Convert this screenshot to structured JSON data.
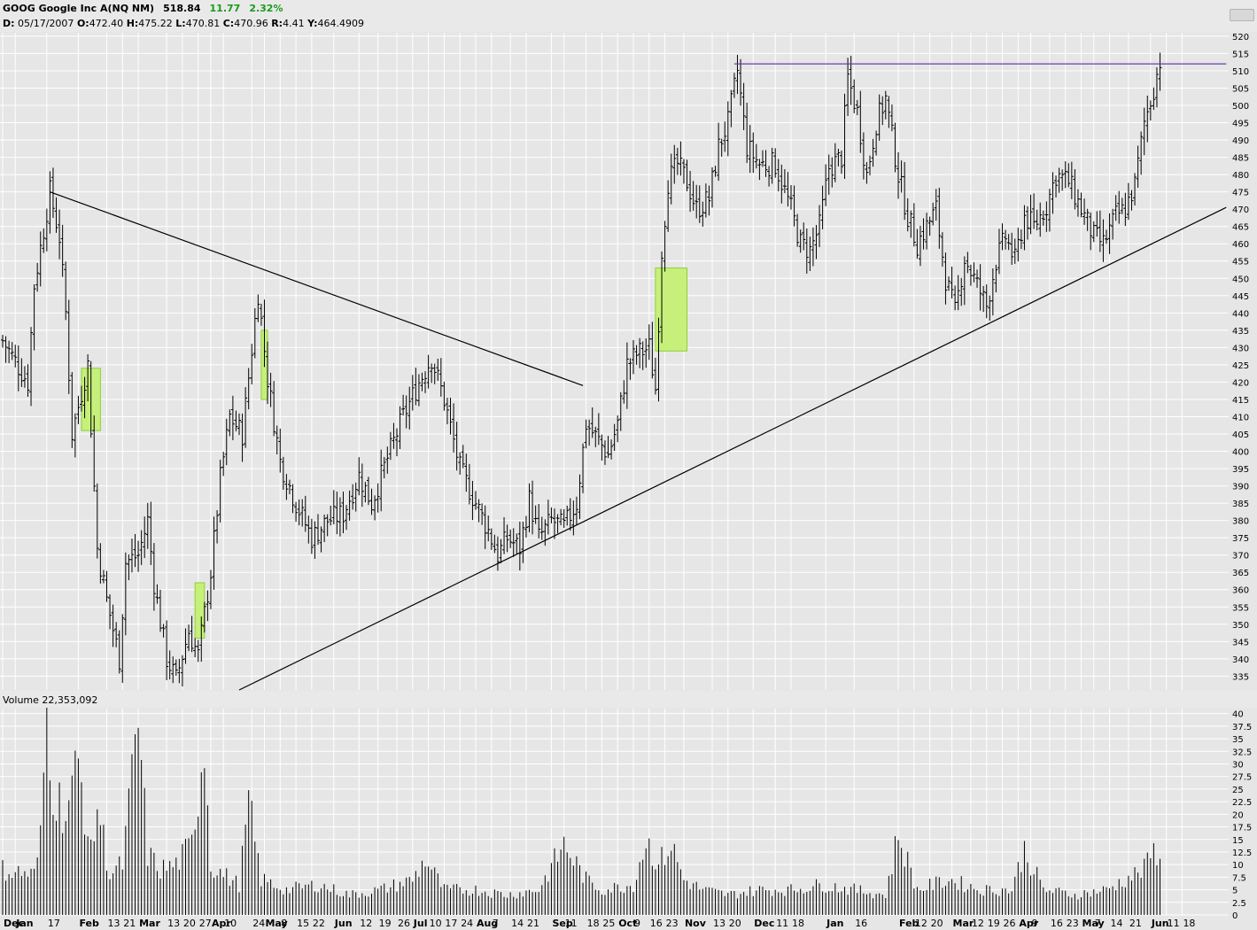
{
  "header": {
    "symbol_name": "GOOG Google Inc A(NQ NM)",
    "last_price": "518.84",
    "change": "11.77",
    "change_pct": "2.32%",
    "change_color": "#1a9a1a"
  },
  "ohlc": {
    "d_label": "D:",
    "date": "05/17/2007",
    "o_label": "O:",
    "open": "472.40",
    "h_label": "H:",
    "high": "475.22",
    "l_label": "L:",
    "low": "470.81",
    "c_label": "C:",
    "close": "470.96",
    "r_label": "R:",
    "range": "4.41",
    "y_label": "Y:",
    "y_value": "464.4909"
  },
  "volume_panel": {
    "label": "Volume 22,353,092"
  },
  "colors": {
    "background": "#e6e6e6",
    "grid": "#ffffff",
    "bars": "#000000",
    "trendlines": "#000000",
    "resistance_line": "#6a3cb4",
    "gap_box_fill": "#c6f07a",
    "gap_box_stroke": "#8ed03a"
  },
  "chart_data": {
    "type": "ohlc",
    "price_axis": {
      "ylim": [
        331,
        521
      ],
      "ticks": [
        335,
        340,
        345,
        350,
        355,
        360,
        365,
        370,
        375,
        380,
        385,
        390,
        395,
        400,
        405,
        410,
        415,
        420,
        425,
        430,
        435,
        440,
        445,
        450,
        455,
        460,
        465,
        470,
        475,
        480,
        485,
        490,
        495,
        500,
        505,
        510,
        515,
        520
      ],
      "position": "right",
      "grid": true
    },
    "volume_axis": {
      "ylim": [
        0,
        41
      ],
      "ticks": [
        "0",
        "2.5",
        "5",
        "7.5",
        "10",
        "12.5",
        "15",
        "17.5",
        "20",
        "22.5",
        "25",
        "27.5",
        "30",
        "32.5",
        "35",
        "37.5",
        "40"
      ],
      "unit": "millions",
      "position": "right",
      "grid": true
    },
    "x_axis": {
      "tick_labels": [
        {
          "i": 0,
          "label": "Dec",
          "bold": true
        },
        {
          "i": 4,
          "label": "Jan",
          "bold": true
        },
        {
          "i": 14,
          "label": "17",
          "bold": false
        },
        {
          "i": 24,
          "label": "Feb",
          "bold": true
        },
        {
          "i": 33,
          "label": "13",
          "bold": false
        },
        {
          "i": 38,
          "label": "21",
          "bold": false
        },
        {
          "i": 43,
          "label": "Mar",
          "bold": true
        },
        {
          "i": 52,
          "label": "13",
          "bold": false
        },
        {
          "i": 57,
          "label": "20",
          "bold": false
        },
        {
          "i": 62,
          "label": "27",
          "bold": false
        },
        {
          "i": 66,
          "label": "Apr",
          "bold": true
        },
        {
          "i": 70,
          "label": "10",
          "bold": false
        },
        {
          "i": 79,
          "label": "24",
          "bold": false
        },
        {
          "i": 83,
          "label": "May",
          "bold": true
        },
        {
          "i": 88,
          "label": "8",
          "bold": false
        },
        {
          "i": 93,
          "label": "15",
          "bold": false
        },
        {
          "i": 98,
          "label": "22",
          "bold": false
        },
        {
          "i": 105,
          "label": "Jun",
          "bold": true
        },
        {
          "i": 113,
          "label": "12",
          "bold": false
        },
        {
          "i": 119,
          "label": "19",
          "bold": false
        },
        {
          "i": 125,
          "label": "26",
          "bold": false
        },
        {
          "i": 130,
          "label": "Jul",
          "bold": true
        },
        {
          "i": 135,
          "label": "10",
          "bold": false
        },
        {
          "i": 140,
          "label": "17",
          "bold": false
        },
        {
          "i": 145,
          "label": "24",
          "bold": false
        },
        {
          "i": 150,
          "label": "Aug",
          "bold": true
        },
        {
          "i": 155,
          "label": "7",
          "bold": false
        },
        {
          "i": 161,
          "label": "14",
          "bold": false
        },
        {
          "i": 166,
          "label": "21",
          "bold": false
        },
        {
          "i": 174,
          "label": "Sep",
          "bold": true
        },
        {
          "i": 178,
          "label": "11",
          "bold": false
        },
        {
          "i": 185,
          "label": "18",
          "bold": false
        },
        {
          "i": 190,
          "label": "25",
          "bold": false
        },
        {
          "i": 195,
          "label": "Oct",
          "bold": true
        },
        {
          "i": 200,
          "label": "9",
          "bold": false
        },
        {
          "i": 205,
          "label": "16",
          "bold": false
        },
        {
          "i": 210,
          "label": "23",
          "bold": false
        },
        {
          "i": 216,
          "label": "Nov",
          "bold": true
        },
        {
          "i": 225,
          "label": "13",
          "bold": false
        },
        {
          "i": 230,
          "label": "20",
          "bold": false
        },
        {
          "i": 238,
          "label": "Dec",
          "bold": true
        },
        {
          "i": 245,
          "label": "11",
          "bold": false
        },
        {
          "i": 250,
          "label": "18",
          "bold": false
        },
        {
          "i": 261,
          "label": "Jan",
          "bold": true
        },
        {
          "i": 270,
          "label": "16",
          "bold": false
        },
        {
          "i": 284,
          "label": "Feb",
          "bold": true
        },
        {
          "i": 289,
          "label": "12",
          "bold": false
        },
        {
          "i": 294,
          "label": "20",
          "bold": false
        },
        {
          "i": 301,
          "label": "Mar",
          "bold": true
        },
        {
          "i": 307,
          "label": "12",
          "bold": false
        },
        {
          "i": 312,
          "label": "19",
          "bold": false
        },
        {
          "i": 317,
          "label": "26",
          "bold": false
        },
        {
          "i": 322,
          "label": "Apr",
          "bold": true
        },
        {
          "i": 326,
          "label": "9",
          "bold": false
        },
        {
          "i": 332,
          "label": "16",
          "bold": false
        },
        {
          "i": 337,
          "label": "23",
          "bold": false
        },
        {
          "i": 342,
          "label": "May",
          "bold": true
        },
        {
          "i": 346,
          "label": "7",
          "bold": false
        },
        {
          "i": 351,
          "label": "14",
          "bold": false
        },
        {
          "i": 357,
          "label": "21",
          "bold": false
        },
        {
          "i": 364,
          "label": "Jun",
          "bold": true
        },
        {
          "i": 369,
          "label": "11",
          "bold": false
        },
        {
          "i": 374,
          "label": "18",
          "bold": false
        }
      ]
    },
    "price_keypoints": [
      [
        0,
        432
      ],
      [
        8,
        420
      ],
      [
        10,
        448
      ],
      [
        15,
        475
      ],
      [
        18,
        462
      ],
      [
        20,
        440
      ],
      [
        22,
        405
      ],
      [
        27,
        425
      ],
      [
        30,
        372
      ],
      [
        33,
        357
      ],
      [
        37,
        340
      ],
      [
        39,
        368
      ],
      [
        43,
        370
      ],
      [
        46,
        380
      ],
      [
        48,
        362
      ],
      [
        52,
        340
      ],
      [
        55,
        334
      ],
      [
        59,
        348
      ],
      [
        62,
        341
      ],
      [
        66,
        365
      ],
      [
        69,
        392
      ],
      [
        72,
        410
      ],
      [
        76,
        405
      ],
      [
        81,
        446
      ],
      [
        84,
        421
      ],
      [
        88,
        397
      ],
      [
        93,
        385
      ],
      [
        98,
        375
      ],
      [
        103,
        380
      ],
      [
        108,
        382
      ],
      [
        113,
        393
      ],
      [
        117,
        385
      ],
      [
        122,
        398
      ],
      [
        127,
        410
      ],
      [
        132,
        420
      ],
      [
        136,
        427
      ],
      [
        140,
        415
      ],
      [
        145,
        395
      ],
      [
        150,
        385
      ],
      [
        154,
        377
      ],
      [
        157,
        370
      ],
      [
        160,
        375
      ],
      [
        164,
        372
      ],
      [
        167,
        386
      ],
      [
        170,
        375
      ],
      [
        174,
        380
      ],
      [
        178,
        378
      ],
      [
        182,
        385
      ],
      [
        185,
        408
      ],
      [
        189,
        403
      ],
      [
        192,
        399
      ],
      [
        195,
        408
      ],
      [
        198,
        425
      ],
      [
        201,
        428
      ],
      [
        205,
        430
      ],
      [
        207,
        418
      ],
      [
        209,
        458
      ],
      [
        211,
        478
      ],
      [
        214,
        483
      ],
      [
        217,
        478
      ],
      [
        220,
        470
      ],
      [
        224,
        473
      ],
      [
        227,
        488
      ],
      [
        230,
        495
      ],
      [
        233,
        510
      ],
      [
        236,
        488
      ],
      [
        240,
        483
      ],
      [
        245,
        483
      ],
      [
        250,
        470
      ],
      [
        253,
        460
      ],
      [
        256,
        458
      ],
      [
        259,
        465
      ],
      [
        262,
        482
      ],
      [
        266,
        485
      ],
      [
        268,
        508
      ],
      [
        271,
        498
      ],
      [
        274,
        480
      ],
      [
        277,
        495
      ],
      [
        280,
        502
      ],
      [
        284,
        480
      ],
      [
        287,
        468
      ],
      [
        290,
        460
      ],
      [
        293,
        465
      ],
      [
        296,
        470
      ],
      [
        299,
        450
      ],
      [
        302,
        440
      ],
      [
        305,
        456
      ],
      [
        309,
        448
      ],
      [
        312,
        442
      ],
      [
        315,
        455
      ],
      [
        318,
        462
      ],
      [
        321,
        455
      ],
      [
        324,
        468
      ],
      [
        327,
        465
      ],
      [
        331,
        471
      ],
      [
        334,
        480
      ],
      [
        338,
        478
      ],
      [
        342,
        470
      ],
      [
        346,
        462
      ],
      [
        349,
        460
      ],
      [
        353,
        468
      ],
      [
        356,
        470
      ],
      [
        359,
        477
      ],
      [
        362,
        495
      ],
      [
        365,
        505
      ],
      [
        367,
        513
      ]
    ],
    "volume_keypoints": [
      [
        0,
        9
      ],
      [
        10,
        8
      ],
      [
        12,
        15
      ],
      [
        14,
        42
      ],
      [
        16,
        25
      ],
      [
        20,
        20
      ],
      [
        24,
        30
      ],
      [
        28,
        12
      ],
      [
        30,
        22
      ],
      [
        34,
        8
      ],
      [
        38,
        10
      ],
      [
        43,
        38
      ],
      [
        46,
        12
      ],
      [
        50,
        9
      ],
      [
        55,
        10
      ],
      [
        60,
        14
      ],
      [
        64,
        35
      ],
      [
        66,
        10
      ],
      [
        70,
        8
      ],
      [
        75,
        6
      ],
      [
        78,
        22
      ],
      [
        82,
        7
      ],
      [
        90,
        5
      ],
      [
        100,
        6
      ],
      [
        110,
        4
      ],
      [
        120,
        5
      ],
      [
        130,
        7
      ],
      [
        134,
        11
      ],
      [
        140,
        5
      ],
      [
        150,
        5
      ],
      [
        160,
        4
      ],
      [
        170,
        5
      ],
      [
        178,
        14
      ],
      [
        185,
        7
      ],
      [
        190,
        5
      ],
      [
        200,
        6
      ],
      [
        204,
        15
      ],
      [
        208,
        10
      ],
      [
        212,
        14
      ],
      [
        216,
        7
      ],
      [
        222,
        5
      ],
      [
        230,
        4
      ],
      [
        240,
        5
      ],
      [
        250,
        5
      ],
      [
        260,
        6
      ],
      [
        270,
        5
      ],
      [
        280,
        4
      ],
      [
        284,
        16
      ],
      [
        290,
        5
      ],
      [
        300,
        7
      ],
      [
        310,
        5
      ],
      [
        320,
        5
      ],
      [
        324,
        13
      ],
      [
        330,
        5
      ],
      [
        340,
        4
      ],
      [
        350,
        5
      ],
      [
        356,
        7
      ],
      [
        362,
        9
      ],
      [
        364,
        12
      ],
      [
        367,
        13
      ]
    ],
    "annotations": {
      "trendlines": [
        {
          "name": "descending-trendline",
          "from": [
            15,
            475
          ],
          "to": [
            184,
            419
          ]
        },
        {
          "name": "ascending-trendline",
          "from": [
            75,
            331
          ],
          "to": [
            388,
            470.5
          ]
        }
      ],
      "resistance_line": {
        "from": [
          232,
          512
        ],
        "to": [
          388,
          512
        ]
      },
      "gap_boxes": [
        {
          "name": "gap-box-1",
          "i_from": 25,
          "i_to": 31,
          "low": 406,
          "high": 424
        },
        {
          "name": "gap-box-2",
          "i_from": 61,
          "i_to": 64,
          "low": 346,
          "high": 362
        },
        {
          "name": "gap-box-3",
          "i_from": 82,
          "i_to": 84,
          "low": 415,
          "high": 435
        },
        {
          "name": "gap-box-4",
          "i_from": 207,
          "i_to": 217,
          "low": 429,
          "high": 453
        }
      ]
    }
  }
}
